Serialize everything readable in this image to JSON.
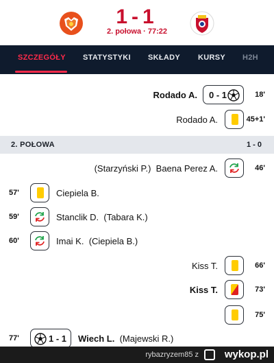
{
  "match": {
    "score": "1-1",
    "status": "2. połowa · 77:22"
  },
  "tabs": [
    {
      "label": "SZCZEGÓŁY",
      "active": true
    },
    {
      "label": "STATYSTYKI",
      "active": false
    },
    {
      "label": "SKŁADY",
      "active": false
    },
    {
      "label": "KURSY",
      "active": false
    },
    {
      "label": "H2H",
      "active": false
    }
  ],
  "first_half_events": [
    {
      "side": "away",
      "type": "goal",
      "player": "Rodado A.",
      "score": "0 - 1",
      "minute": "18'"
    },
    {
      "side": "away",
      "type": "yellow-card",
      "player": "Rodado A.",
      "minute": "45+1'"
    }
  ],
  "second_half": {
    "label": "2. POŁOWA",
    "score": "1 - 0"
  },
  "second_half_events": [
    {
      "side": "away",
      "type": "substitution",
      "player_in": "Baena Perez A.",
      "player_out": "(Starzyński P.)",
      "minute": "46'"
    },
    {
      "side": "home",
      "type": "yellow-card",
      "player": "Ciepiela B.",
      "minute": "57'"
    },
    {
      "side": "home",
      "type": "substitution",
      "player_in": "Stanclik D.",
      "player_out": "(Tabara K.)",
      "minute": "59'"
    },
    {
      "side": "home",
      "type": "substitution",
      "player_in": "Imai K.",
      "player_out": "(Ciepiela B.)",
      "minute": "60'"
    },
    {
      "side": "away",
      "type": "yellow-card",
      "player": "Kiss T.",
      "minute": "66'"
    },
    {
      "side": "away",
      "type": "second-yellow-card",
      "player": "Kiss T.",
      "minute": "73'"
    },
    {
      "side": "away",
      "type": "yellow-card",
      "player": "",
      "minute": "75'"
    },
    {
      "side": "home",
      "type": "goal",
      "player": "Wiech L.",
      "assist": "(Majewski R.)",
      "score": "1 - 1",
      "minute": "77'"
    }
  ],
  "footer": {
    "user": "rybazryzem85",
    "separator": "z",
    "brand": "wykop.pl"
  },
  "colors": {
    "accent": "#c8102e",
    "tab_active": "#ff2a4a",
    "tab_bar": "#0f1b2d",
    "yellow_card": "#ffcc00",
    "red_card": "#e02020",
    "sub_in": "#1fa34a",
    "sub_out": "#e02020"
  },
  "icons": {
    "goal": "soccer-ball-icon",
    "yellow-card": "yellow-card-icon",
    "second-yellow-card": "second-yellow-card-icon",
    "substitution": "substitution-arrows-icon"
  }
}
